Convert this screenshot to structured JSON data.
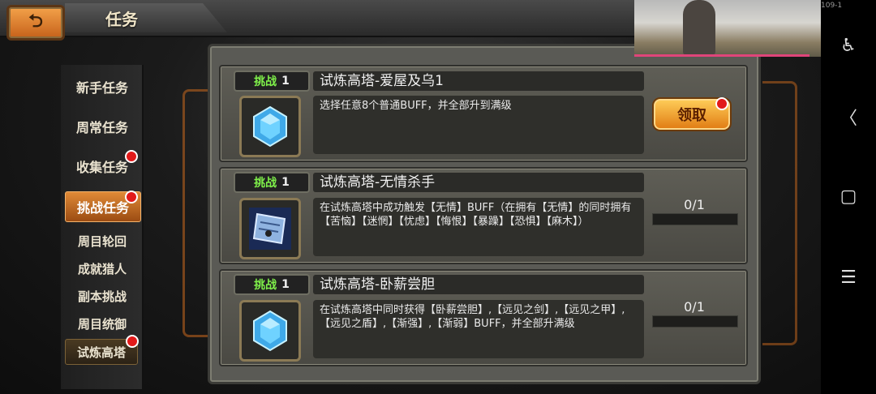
{
  "header": {
    "title": "任务",
    "back_icon": "back-arrow-icon",
    "back_glyph": "⮌"
  },
  "video_overlay": {
    "label": "109-1"
  },
  "menu": {
    "items": [
      {
        "label": "新手任务",
        "dot": false,
        "state": "normal"
      },
      {
        "label": "周常任务",
        "dot": false,
        "state": "normal"
      },
      {
        "label": "收集任务",
        "dot": true,
        "state": "normal"
      },
      {
        "label": "挑战任务",
        "dot": true,
        "state": "active"
      },
      {
        "label": "周目轮回",
        "dot": false,
        "state": "sub"
      },
      {
        "label": "成就猎人",
        "dot": false,
        "state": "sub"
      },
      {
        "label": "副本挑战",
        "dot": false,
        "state": "sub"
      },
      {
        "label": "周目统御",
        "dot": false,
        "state": "sub"
      },
      {
        "label": "试炼高塔",
        "dot": true,
        "state": "selected"
      }
    ]
  },
  "tasks": [
    {
      "badge_label": "挑战",
      "badge_num": "1",
      "name": "试炼高塔-爱屋及乌1",
      "desc": "选择任意8个普通BUFF，并全部升到满级",
      "icon": "blue-gem-icon",
      "action": "领取",
      "action_dot": true
    },
    {
      "badge_label": "挑战",
      "badge_num": "1",
      "name": "试炼高塔-无情杀手",
      "desc": "在试炼高塔中成功触发【无情】BUFF（在拥有【无情】的同时拥有【苦恼】【迷惘】【忧虑】【悔恨】【暴躁】【恐惧】【麻木】）",
      "icon": "scroll-icon",
      "progress": "0/1",
      "progress_value": 0
    },
    {
      "badge_label": "挑战",
      "badge_num": "1",
      "name": "试炼高塔-卧薪尝胆",
      "desc": "在试炼高塔中同时获得【卧薪尝胆】,【远见之剑】,【远见之甲】,【远见之盾】,【渐强】,【渐弱】BUFF，并全部升满级",
      "icon": "blue-gem-icon",
      "progress": "0/1",
      "progress_value": 0
    }
  ],
  "nav": {
    "accessibility_glyph": "♿",
    "back_glyph": "〈",
    "home_glyph": "▢",
    "menu_glyph": "☰"
  },
  "colors": {
    "accent": "#e08a37",
    "badge_green": "#7ff04a",
    "dot_red": "#e21a1a"
  }
}
